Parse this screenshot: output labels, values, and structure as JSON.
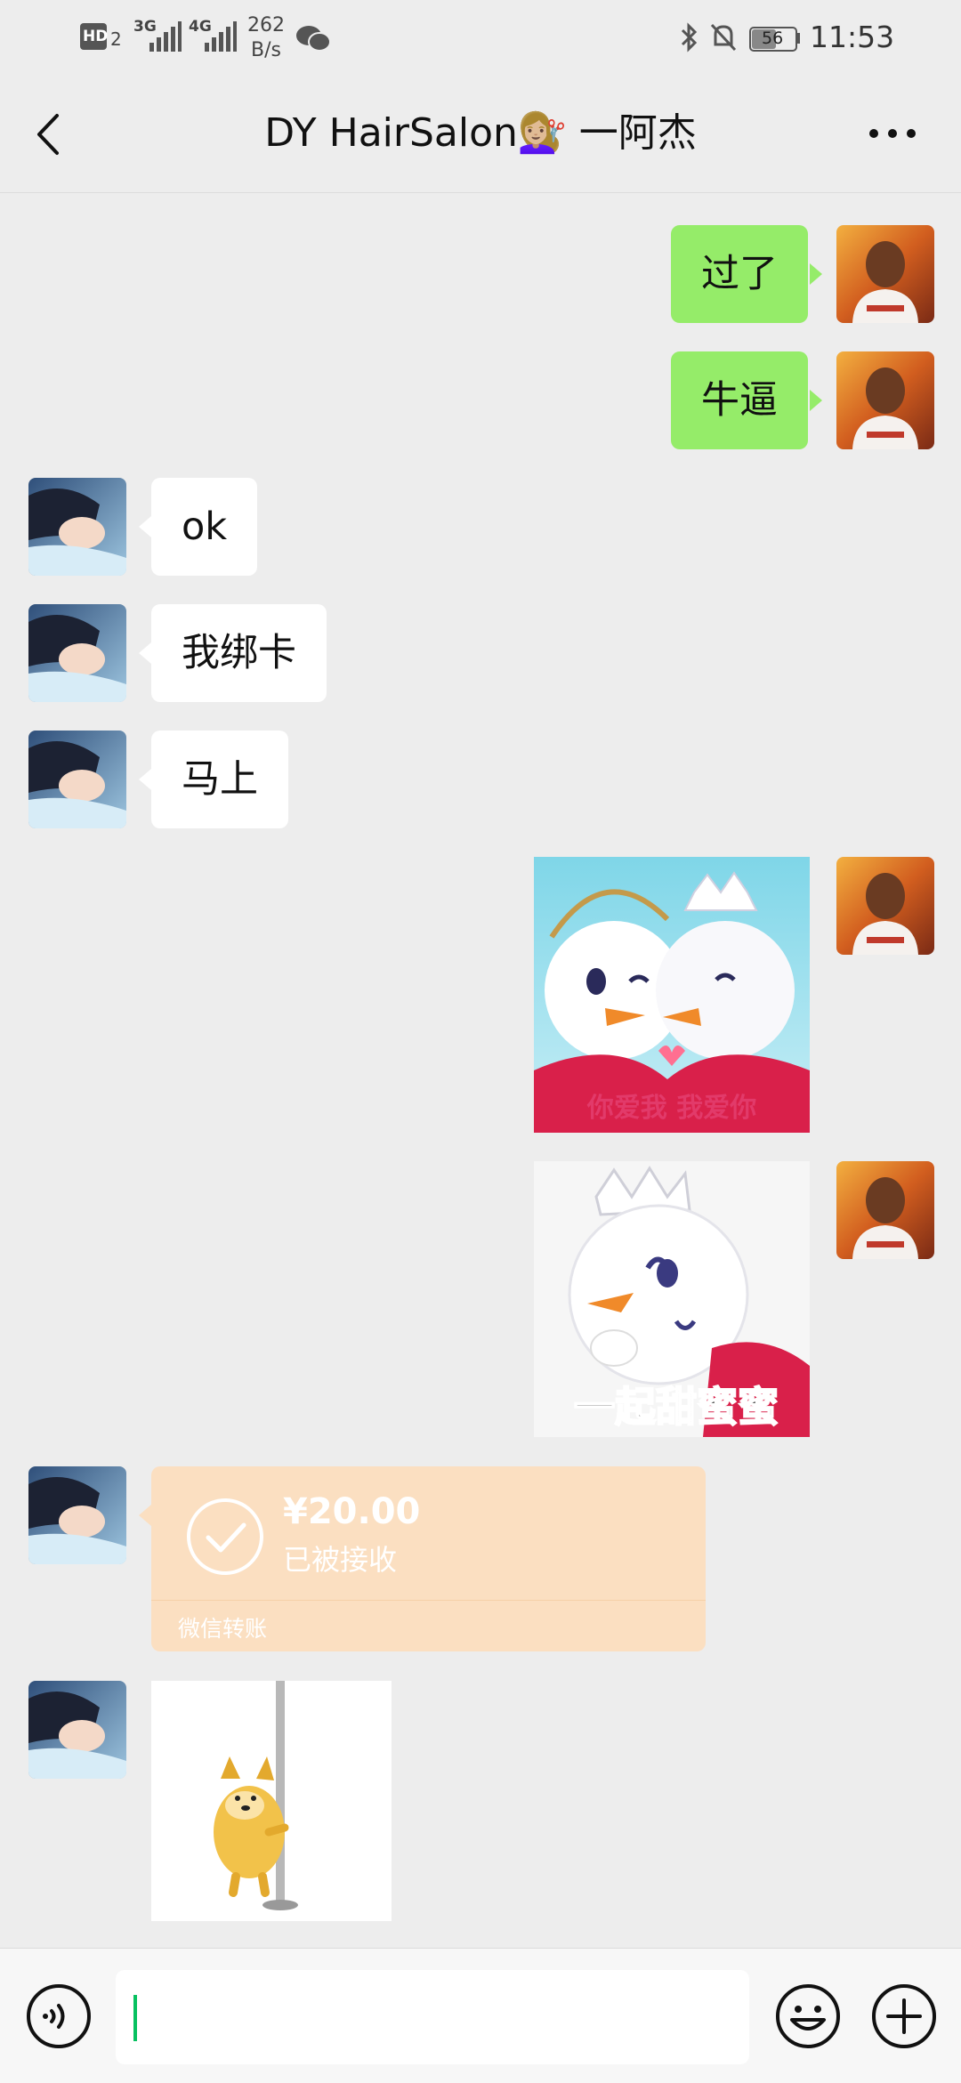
{
  "status_bar": {
    "network_hd": "HD",
    "network_hd_sub": "2",
    "signal1_label": "3G",
    "signal2_label": "4G",
    "speed_value": "262",
    "speed_unit": "B/s",
    "battery": "56",
    "time": "11:53",
    "icons": [
      "wechat-icon",
      "bluetooth-icon",
      "mute-bell-icon",
      "battery-icon"
    ]
  },
  "header": {
    "title": "DY HairSalon💇🏼‍♀️ 一阿杰",
    "back_icon": "chevron-left-icon",
    "more_icon": "more-dots-icon"
  },
  "messages": [
    {
      "side": "me",
      "type": "text",
      "text": "过了"
    },
    {
      "side": "me",
      "type": "text",
      "text": "牛逼"
    },
    {
      "side": "them",
      "type": "text",
      "text": "ok"
    },
    {
      "side": "them",
      "type": "text",
      "text": "我绑卡"
    },
    {
      "side": "them",
      "type": "text",
      "text": "马上"
    },
    {
      "side": "me",
      "type": "sticker",
      "caption": "你爱我 我爱你"
    },
    {
      "side": "me",
      "type": "sticker",
      "caption": "一起甜蜜蜜"
    },
    {
      "side": "them",
      "type": "transfer",
      "amount": "¥20.00",
      "status": "已被接收",
      "footer": "微信转账"
    },
    {
      "side": "them",
      "type": "sticker",
      "caption": ""
    }
  ],
  "input_bar": {
    "voice_icon": "voice-icon",
    "emoji_icon": "emoji-icon",
    "plus_icon": "plus-icon",
    "text_value": ""
  },
  "colors": {
    "background": "#ededed",
    "my_bubble": "#95ec69",
    "their_bubble": "#ffffff",
    "transfer_card": "#fbdfc1",
    "caret": "#07c160"
  }
}
